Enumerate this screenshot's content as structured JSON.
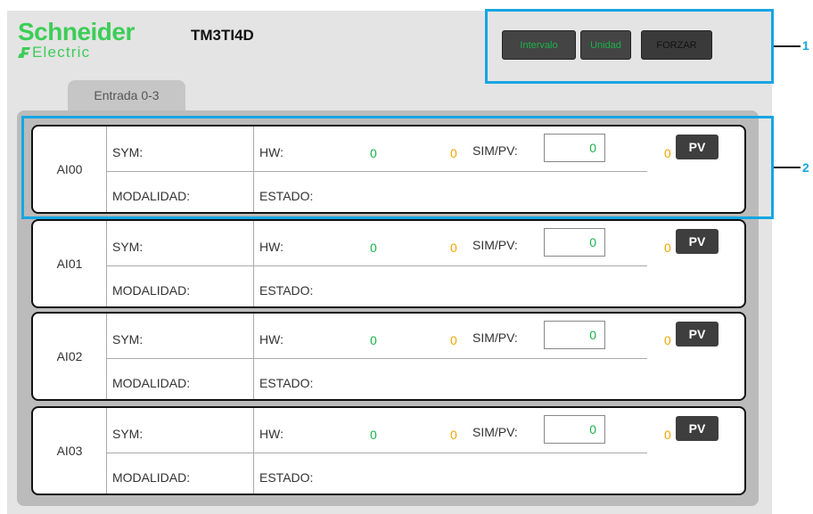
{
  "header": {
    "brand": "Schneider",
    "brand_sub": "Electric",
    "model": "TM3TI4D"
  },
  "toolbar": {
    "interval_label": "Intervalo",
    "unit_label": "Unidad",
    "force_label": "FORZAR"
  },
  "tab": {
    "label": "Entrada 0-3"
  },
  "labels": {
    "sym": "SYM:",
    "mode": "MODALIDAD:",
    "hw": "HW:",
    "status": "ESTADO:",
    "sim": "SIM/PV:",
    "pv": "PV"
  },
  "channels": [
    {
      "name": "AI00",
      "hw": "0",
      "overflow": "0",
      "sim_value": "0",
      "pv_value": "0"
    },
    {
      "name": "AI01",
      "hw": "0",
      "overflow": "0",
      "sim_value": "0",
      "pv_value": "0"
    },
    {
      "name": "AI02",
      "hw": "0",
      "overflow": "0",
      "sim_value": "0",
      "pv_value": "0"
    },
    {
      "name": "AI03",
      "hw": "0",
      "overflow": "0",
      "sim_value": "0",
      "pv_value": "0"
    }
  ],
  "callouts": [
    "1",
    "2"
  ],
  "colors": {
    "brand": "#3dcd58",
    "value": "#1bb34a",
    "overflow": "#f0a500",
    "callout": "#16a6e2"
  }
}
